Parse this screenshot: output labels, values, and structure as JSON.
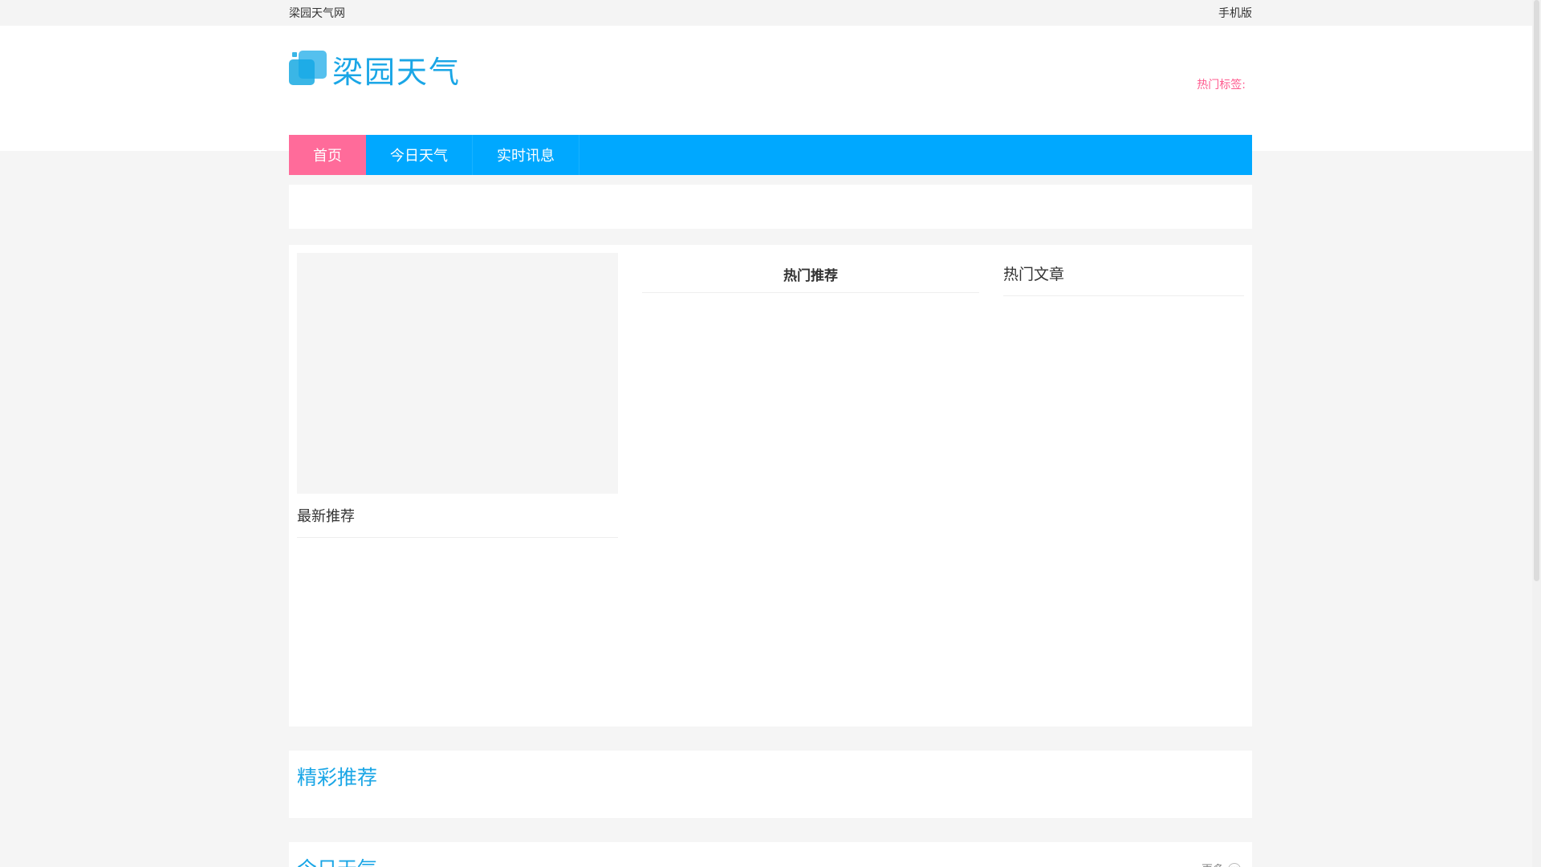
{
  "topbar": {
    "site_name": "梁园天气网",
    "mobile_link": "手机版"
  },
  "header": {
    "logo_text": "梁园天气",
    "hot_tags_label": "热门标签:"
  },
  "nav": {
    "items": [
      {
        "label": "首页",
        "active": true
      },
      {
        "label": "今日天气",
        "active": false
      },
      {
        "label": "实时讯息",
        "active": false
      }
    ]
  },
  "main": {
    "left_title": "最新推荐",
    "mid_title": "热门推荐",
    "right_title": "热门文章"
  },
  "sections": {
    "featured_title": "精彩推荐",
    "today_title": "今日天气",
    "more_label": "更多"
  },
  "colors": {
    "nav_bg": "#00a8ff",
    "nav_active": "#ff6b9a",
    "accent": "#1aa6e6",
    "hot_tags": "#ff5b8f"
  }
}
